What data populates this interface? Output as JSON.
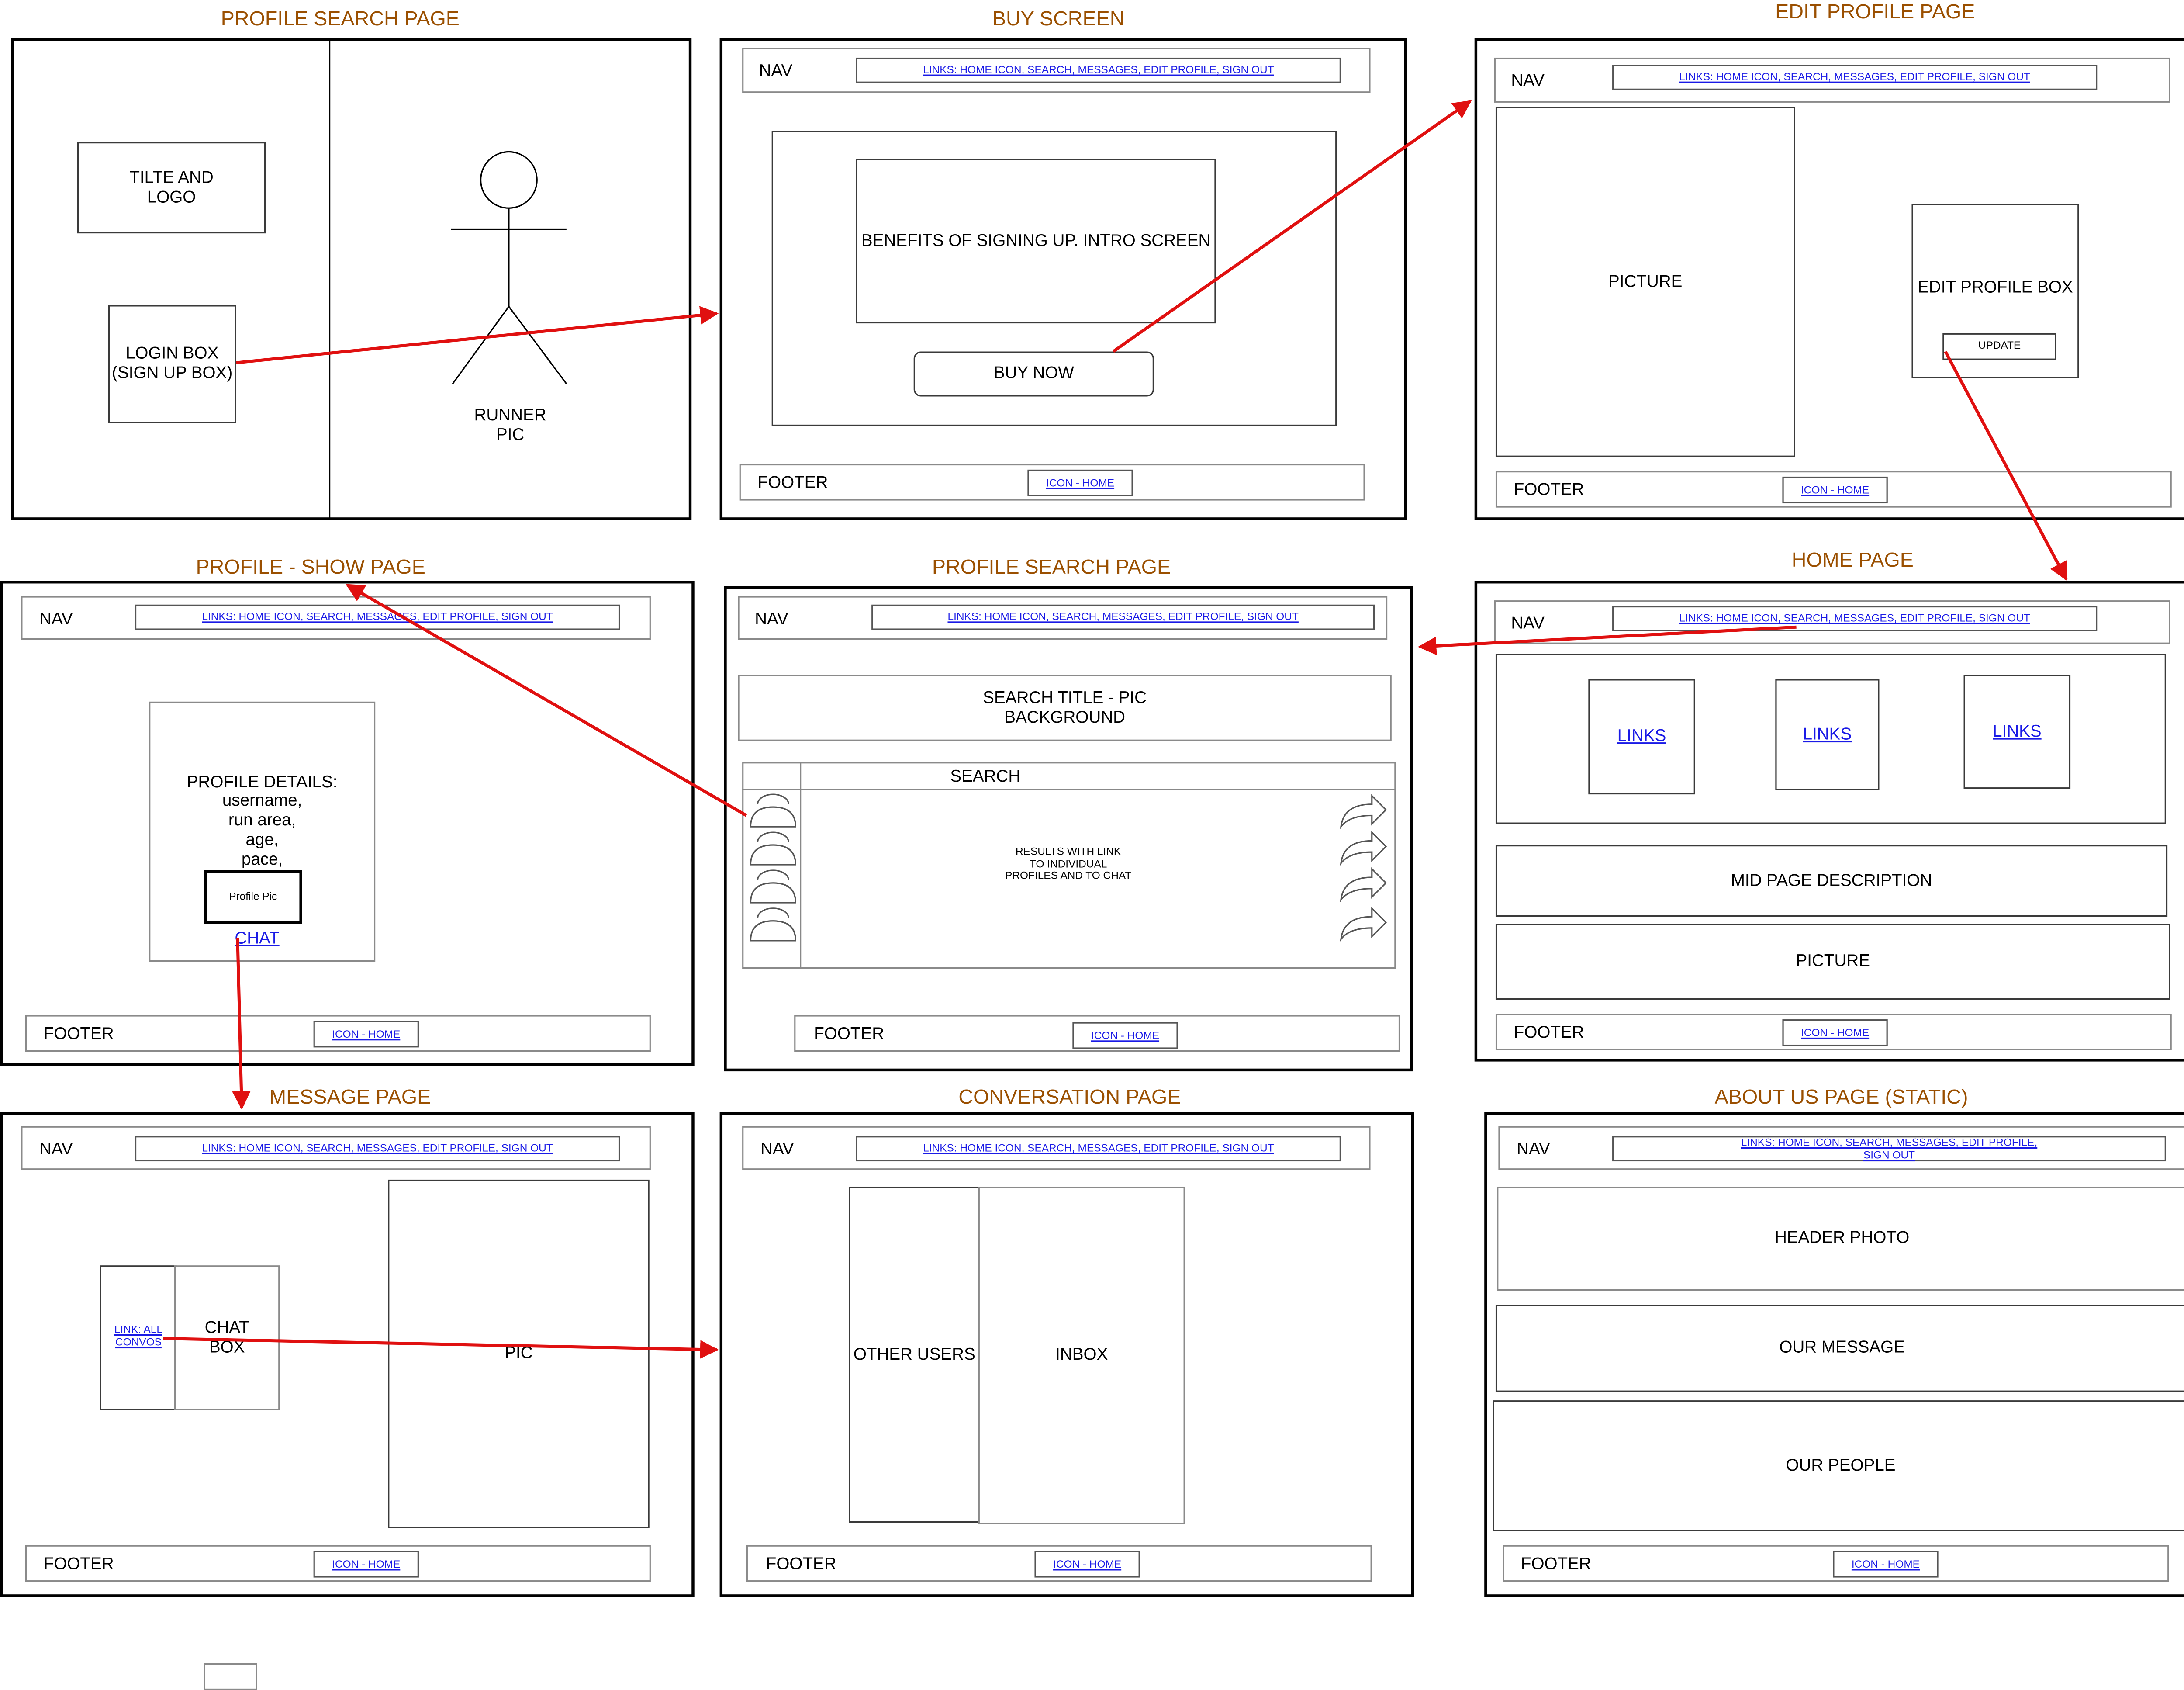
{
  "common": {
    "nav_label": "NAV",
    "nav_links": "LINKS:  HOME ICON, SEARCH, MESSAGES, EDIT PROFILE, SIGN OUT",
    "footer_label": "FOOTER",
    "footer_link": "ICON - HOME"
  },
  "profile_search_top": {
    "title": "PROFILE SEARCH PAGE",
    "title_logo": "TILTE AND\nLOGO",
    "login_box": "LOGIN BOX\n(SIGN UP BOX)",
    "runner_pic": "RUNNER\nPIC"
  },
  "buy_screen": {
    "title": "BUY SCREEN",
    "intro": "BENEFITS OF SIGNING UP. INTRO SCREEN",
    "buy_button": "BUY NOW"
  },
  "edit_profile": {
    "title": "EDIT PROFILE PAGE",
    "picture": "PICTURE",
    "edit_box": "EDIT PROFILE BOX",
    "update_button": "UPDATE"
  },
  "profile_show": {
    "title": "PROFILE - SHOW PAGE",
    "details": "PROFILE DETAILS:\nusername,\nrun area,\nage,\npace,",
    "profile_pic": "Profile Pic",
    "chat_link": "CHAT"
  },
  "profile_search_mid": {
    "title": "PROFILE SEARCH PAGE",
    "search_title": "SEARCH TITLE - PIC\nBACKGROUND",
    "search_label": "SEARCH",
    "results": "RESULTS WITH LINK\nTO INDIVIDUAL\nPROFILES AND TO CHAT"
  },
  "home_page": {
    "title": "HOME PAGE",
    "links": [
      "LINKS",
      "LINKS",
      "LINKS"
    ],
    "mid_description": "MID PAGE DESCRIPTION",
    "picture": "PICTURE"
  },
  "message_page": {
    "title": "MESSAGE PAGE",
    "all_convos_link": "LINK: ALL\nCONVOS",
    "chat_box": "CHAT\nBOX",
    "pic": "PIC"
  },
  "conversation_page": {
    "title": "CONVERSATION PAGE",
    "other_users": "OTHER USERS",
    "inbox": "INBOX"
  },
  "about_page": {
    "title": "ABOUT US PAGE (STATIC)",
    "header_photo": "HEADER PHOTO",
    "our_message": "OUR MESSAGE",
    "our_people": "OUR PEOPLE"
  },
  "colors": {
    "title": "#9a4f00",
    "arrow": "#e01010",
    "link": "#1a1ae6"
  }
}
